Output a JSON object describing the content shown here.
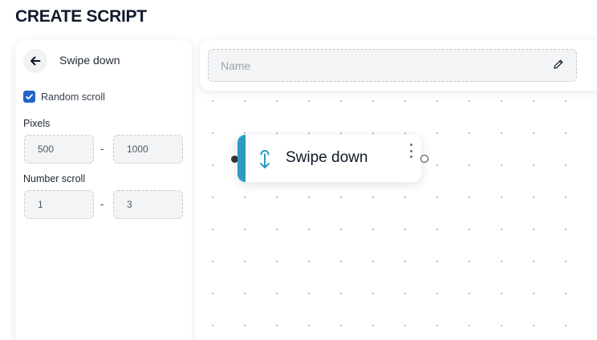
{
  "page": {
    "title": "CREATE SCRIPT"
  },
  "panel": {
    "title": "Swipe down",
    "back_icon": "arrow-left-icon",
    "random_scroll": {
      "label": "Random scroll",
      "checked": true
    },
    "pixels": {
      "label": "Pixels",
      "min": "500",
      "max": "1000",
      "separator": "-"
    },
    "number_scroll": {
      "label": "Number scroll",
      "min": "1",
      "max": "3",
      "separator": "-"
    }
  },
  "toolbar": {
    "name_placeholder": "Name",
    "edit_icon": "pencil-icon"
  },
  "node": {
    "label": "Swipe down",
    "icon": "swipe-down-icon",
    "accent_color": "#2b9bbf"
  },
  "colors": {
    "checkbox": "#2563c9",
    "title": "#0f1a2b"
  }
}
